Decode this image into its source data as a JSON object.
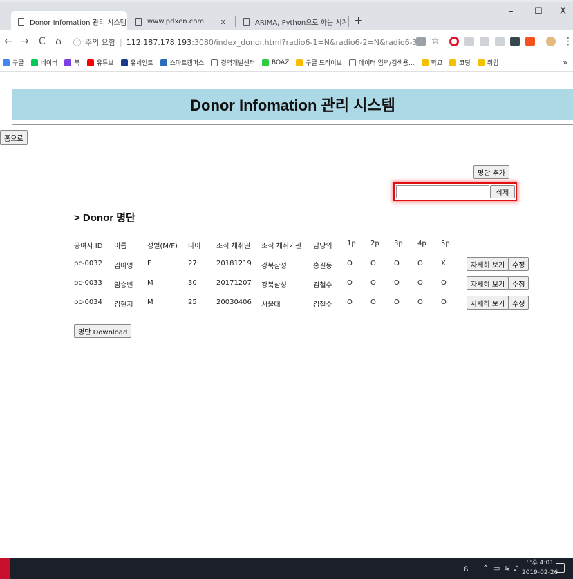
{
  "browser": {
    "tabs": [
      {
        "title": "Donor Infomation 관리 시스템",
        "active": true
      },
      {
        "title": "www.pdxen.com",
        "active": false
      },
      {
        "title": "ARIMA, Python으로 하는 시계열",
        "active": false
      }
    ],
    "tab_close": "x",
    "new_tab": "+",
    "window": {
      "minimize": "–",
      "maximize": "☐",
      "close": "X"
    },
    "nav": {
      "back": "←",
      "forward": "→",
      "reload": "C",
      "home": "⌂"
    },
    "address": {
      "warning_icon": "ⓘ",
      "warning": "주의 요함",
      "host": "112.187.178.193",
      "path": ":3080/index_donor.html?radio6-1=N&radio6-2=N&radio6-3=N&radio6-4=N..."
    },
    "bookmarks": [
      {
        "label": "구글",
        "icon_color": "#4285f4"
      },
      {
        "label": "네이버",
        "icon_color": "#03c75a"
      },
      {
        "label": "북",
        "icon_color": "#7b3fe4"
      },
      {
        "label": "유튜브",
        "icon_color": "#ff0000"
      },
      {
        "label": "유세인트",
        "icon_color": "#1a3a8f"
      },
      {
        "label": "스마트캠퍼스",
        "icon_color": "#2a6ebb"
      },
      {
        "label": "경력개발센터",
        "icon_color": "#666666"
      },
      {
        "label": "BOAZ",
        "icon_color": "#2ecc40"
      },
      {
        "label": "구글 드라이브",
        "icon_color": "#fbbc04"
      },
      {
        "label": "데이터 입력/검색용...",
        "icon_color": "#666666"
      },
      {
        "label": "학교",
        "icon_color": "#f2c200"
      },
      {
        "label": "코딩",
        "icon_color": "#f2c200"
      },
      {
        "label": "취업",
        "icon_color": "#f2c200"
      }
    ],
    "bookmarks_more": "»"
  },
  "page": {
    "title": "Donor Infomation 관리 시스템",
    "home_button": "홈으로",
    "add_button": "명단 추가",
    "delete_input_value": "",
    "delete_button": "삭제",
    "section_title": "> Donor 명단",
    "table": {
      "headers": [
        "공여자 ID",
        "이름",
        "성별(M/F)",
        "나이",
        "조직 채취일",
        "조직 채취기관",
        "담당의",
        "1p",
        "2p",
        "3p",
        "4p",
        "5p"
      ],
      "rows": [
        [
          "pc-0032",
          "김아영",
          "F",
          "27",
          "20181219",
          "강북삼성",
          "홍길동",
          "O",
          "O",
          "O",
          "O",
          "X"
        ],
        [
          "pc-0033",
          "임승빈",
          "M",
          "30",
          "20171207",
          "강북삼성",
          "김철수",
          "O",
          "O",
          "O",
          "O",
          "O"
        ],
        [
          "pc-0034",
          "김현지",
          "M",
          "25",
          "20030406",
          "서울대",
          "김철수",
          "O",
          "O",
          "O",
          "O",
          "O"
        ]
      ],
      "detail_button": "자세히 보기",
      "edit_button": "수정"
    },
    "download_button": "명단 Download"
  },
  "taskbar": {
    "time": "오후 4:01",
    "date": "2019-02-26"
  },
  "colors": {
    "header_band": "#add8e6",
    "highlight": "#e01010"
  }
}
